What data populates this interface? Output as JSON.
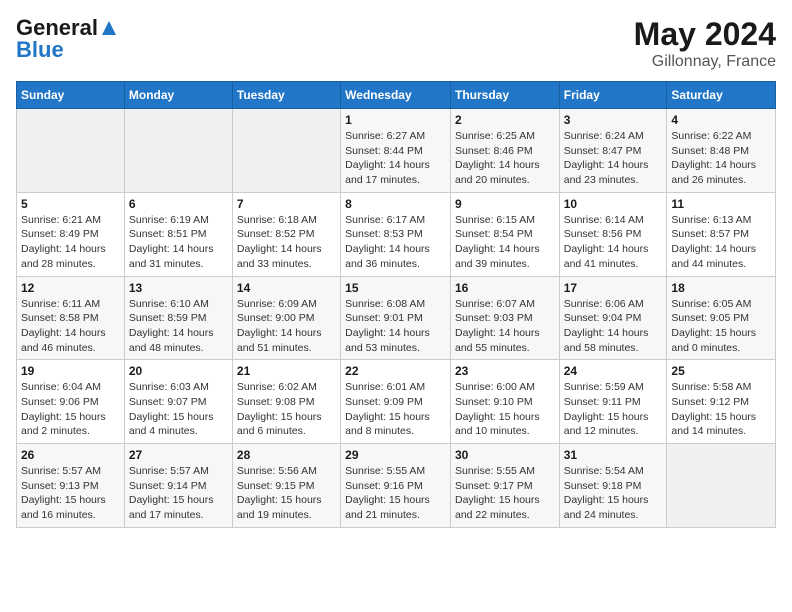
{
  "logo": {
    "line1": "General",
    "line2": "Blue"
  },
  "title": "May 2024",
  "subtitle": "Gillonnay, France",
  "days_of_week": [
    "Sunday",
    "Monday",
    "Tuesday",
    "Wednesday",
    "Thursday",
    "Friday",
    "Saturday"
  ],
  "weeks": [
    [
      {
        "day": "",
        "detail": ""
      },
      {
        "day": "",
        "detail": ""
      },
      {
        "day": "",
        "detail": ""
      },
      {
        "day": "1",
        "detail": "Sunrise: 6:27 AM\nSunset: 8:44 PM\nDaylight: 14 hours\nand 17 minutes."
      },
      {
        "day": "2",
        "detail": "Sunrise: 6:25 AM\nSunset: 8:46 PM\nDaylight: 14 hours\nand 20 minutes."
      },
      {
        "day": "3",
        "detail": "Sunrise: 6:24 AM\nSunset: 8:47 PM\nDaylight: 14 hours\nand 23 minutes."
      },
      {
        "day": "4",
        "detail": "Sunrise: 6:22 AM\nSunset: 8:48 PM\nDaylight: 14 hours\nand 26 minutes."
      }
    ],
    [
      {
        "day": "5",
        "detail": "Sunrise: 6:21 AM\nSunset: 8:49 PM\nDaylight: 14 hours\nand 28 minutes."
      },
      {
        "day": "6",
        "detail": "Sunrise: 6:19 AM\nSunset: 8:51 PM\nDaylight: 14 hours\nand 31 minutes."
      },
      {
        "day": "7",
        "detail": "Sunrise: 6:18 AM\nSunset: 8:52 PM\nDaylight: 14 hours\nand 33 minutes."
      },
      {
        "day": "8",
        "detail": "Sunrise: 6:17 AM\nSunset: 8:53 PM\nDaylight: 14 hours\nand 36 minutes."
      },
      {
        "day": "9",
        "detail": "Sunrise: 6:15 AM\nSunset: 8:54 PM\nDaylight: 14 hours\nand 39 minutes."
      },
      {
        "day": "10",
        "detail": "Sunrise: 6:14 AM\nSunset: 8:56 PM\nDaylight: 14 hours\nand 41 minutes."
      },
      {
        "day": "11",
        "detail": "Sunrise: 6:13 AM\nSunset: 8:57 PM\nDaylight: 14 hours\nand 44 minutes."
      }
    ],
    [
      {
        "day": "12",
        "detail": "Sunrise: 6:11 AM\nSunset: 8:58 PM\nDaylight: 14 hours\nand 46 minutes."
      },
      {
        "day": "13",
        "detail": "Sunrise: 6:10 AM\nSunset: 8:59 PM\nDaylight: 14 hours\nand 48 minutes."
      },
      {
        "day": "14",
        "detail": "Sunrise: 6:09 AM\nSunset: 9:00 PM\nDaylight: 14 hours\nand 51 minutes."
      },
      {
        "day": "15",
        "detail": "Sunrise: 6:08 AM\nSunset: 9:01 PM\nDaylight: 14 hours\nand 53 minutes."
      },
      {
        "day": "16",
        "detail": "Sunrise: 6:07 AM\nSunset: 9:03 PM\nDaylight: 14 hours\nand 55 minutes."
      },
      {
        "day": "17",
        "detail": "Sunrise: 6:06 AM\nSunset: 9:04 PM\nDaylight: 14 hours\nand 58 minutes."
      },
      {
        "day": "18",
        "detail": "Sunrise: 6:05 AM\nSunset: 9:05 PM\nDaylight: 15 hours\nand 0 minutes."
      }
    ],
    [
      {
        "day": "19",
        "detail": "Sunrise: 6:04 AM\nSunset: 9:06 PM\nDaylight: 15 hours\nand 2 minutes."
      },
      {
        "day": "20",
        "detail": "Sunrise: 6:03 AM\nSunset: 9:07 PM\nDaylight: 15 hours\nand 4 minutes."
      },
      {
        "day": "21",
        "detail": "Sunrise: 6:02 AM\nSunset: 9:08 PM\nDaylight: 15 hours\nand 6 minutes."
      },
      {
        "day": "22",
        "detail": "Sunrise: 6:01 AM\nSunset: 9:09 PM\nDaylight: 15 hours\nand 8 minutes."
      },
      {
        "day": "23",
        "detail": "Sunrise: 6:00 AM\nSunset: 9:10 PM\nDaylight: 15 hours\nand 10 minutes."
      },
      {
        "day": "24",
        "detail": "Sunrise: 5:59 AM\nSunset: 9:11 PM\nDaylight: 15 hours\nand 12 minutes."
      },
      {
        "day": "25",
        "detail": "Sunrise: 5:58 AM\nSunset: 9:12 PM\nDaylight: 15 hours\nand 14 minutes."
      }
    ],
    [
      {
        "day": "26",
        "detail": "Sunrise: 5:57 AM\nSunset: 9:13 PM\nDaylight: 15 hours\nand 16 minutes."
      },
      {
        "day": "27",
        "detail": "Sunrise: 5:57 AM\nSunset: 9:14 PM\nDaylight: 15 hours\nand 17 minutes."
      },
      {
        "day": "28",
        "detail": "Sunrise: 5:56 AM\nSunset: 9:15 PM\nDaylight: 15 hours\nand 19 minutes."
      },
      {
        "day": "29",
        "detail": "Sunrise: 5:55 AM\nSunset: 9:16 PM\nDaylight: 15 hours\nand 21 minutes."
      },
      {
        "day": "30",
        "detail": "Sunrise: 5:55 AM\nSunset: 9:17 PM\nDaylight: 15 hours\nand 22 minutes."
      },
      {
        "day": "31",
        "detail": "Sunrise: 5:54 AM\nSunset: 9:18 PM\nDaylight: 15 hours\nand 24 minutes."
      },
      {
        "day": "",
        "detail": ""
      }
    ]
  ]
}
